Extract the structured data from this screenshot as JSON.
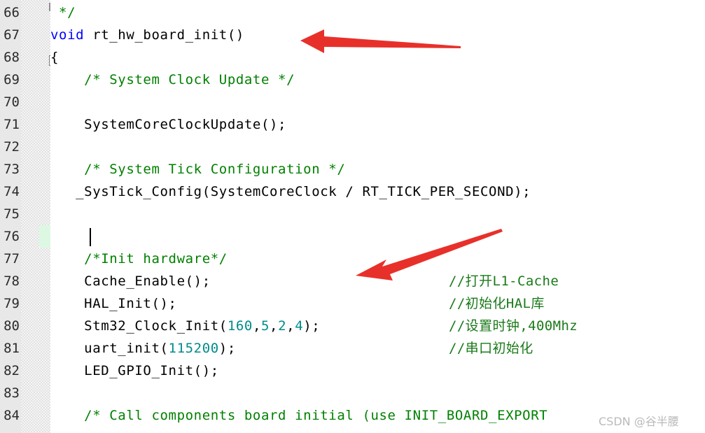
{
  "editor": {
    "language": "c",
    "colors": {
      "keyword": "#0000ff",
      "comment": "#008000",
      "number": "#008b8b",
      "text": "#000000",
      "gutter_bg": "#e8e8e8",
      "fold_bg": "#f5f5f5",
      "current_line_highlight": "#ddf8e2",
      "arrow_accent": "#e8302a",
      "annotation_text": "#1a7a1a"
    },
    "current_line": 76,
    "lines": [
      {
        "no": "66",
        "tokens": [
          {
            "t": " */",
            "c": "cmt"
          }
        ]
      },
      {
        "no": "67",
        "tokens": [
          {
            "t": "void",
            "c": "kw"
          },
          {
            "t": " rt_hw_board_init()",
            "c": "plain"
          }
        ]
      },
      {
        "no": "68",
        "tokens": [
          {
            "t": "{",
            "c": "plain"
          }
        ]
      },
      {
        "no": "69",
        "tokens": [
          {
            "t": "    /* System Clock Update */",
            "c": "cmt"
          }
        ]
      },
      {
        "no": "70",
        "tokens": [
          {
            "t": "",
            "c": "plain"
          }
        ]
      },
      {
        "no": "71",
        "tokens": [
          {
            "t": "    SystemCoreClockUpdate();",
            "c": "plain"
          }
        ]
      },
      {
        "no": "72",
        "tokens": [
          {
            "t": "",
            "c": "plain"
          }
        ]
      },
      {
        "no": "73",
        "tokens": [
          {
            "t": "    /* System Tick Configuration */",
            "c": "cmt"
          }
        ]
      },
      {
        "no": "74",
        "tokens": [
          {
            "t": "   _SysTick_Config(SystemCoreClock / RT_TICK_PER_SECOND);",
            "c": "plain"
          }
        ]
      },
      {
        "no": "75",
        "tokens": [
          {
            "t": "",
            "c": "plain"
          }
        ]
      },
      {
        "no": "76",
        "tokens": [
          {
            "t": "",
            "c": "plain"
          }
        ]
      },
      {
        "no": "77",
        "tokens": [
          {
            "t": "    /*Init hardware*/",
            "c": "cmt"
          }
        ]
      },
      {
        "no": "78",
        "tokens": [
          {
            "t": "    Cache_Enable();",
            "c": "plain"
          }
        ]
      },
      {
        "no": "79",
        "tokens": [
          {
            "t": "    HAL_Init();",
            "c": "plain"
          }
        ]
      },
      {
        "no": "80",
        "tokens": [
          {
            "t": "    Stm32_Clock_Init(",
            "c": "plain"
          },
          {
            "t": "160",
            "c": "num"
          },
          {
            "t": ",",
            "c": "plain"
          },
          {
            "t": "5",
            "c": "num"
          },
          {
            "t": ",",
            "c": "plain"
          },
          {
            "t": "2",
            "c": "num"
          },
          {
            "t": ",",
            "c": "plain"
          },
          {
            "t": "4",
            "c": "num"
          },
          {
            "t": ");",
            "c": "plain"
          }
        ]
      },
      {
        "no": "81",
        "tokens": [
          {
            "t": "    uart_init(",
            "c": "plain"
          },
          {
            "t": "115200",
            "c": "num"
          },
          {
            "t": ");",
            "c": "plain"
          }
        ]
      },
      {
        "no": "82",
        "tokens": [
          {
            "t": "    LED_GPIO_Init();",
            "c": "plain"
          }
        ]
      },
      {
        "no": "83",
        "tokens": [
          {
            "t": "",
            "c": "plain"
          }
        ]
      },
      {
        "no": "84",
        "tokens": [
          {
            "t": "    /* Call components board initial (use INIT_BOARD_EXPORT",
            "c": "cmt"
          }
        ]
      }
    ]
  },
  "annotations": {
    "chinese_comments": [
      {
        "text": "//打开L1-Cache",
        "line": 78
      },
      {
        "text": "//初始化HAL库",
        "line": 79
      },
      {
        "text": "//设置时钟,400Mhz",
        "line": 80
      },
      {
        "text": "//串口初始化",
        "line": 81
      }
    ],
    "arrows": [
      {
        "name": "arrow-to-function-signature",
        "points_to": "rt_hw_board_init()"
      },
      {
        "name": "arrow-to-init-hardware",
        "points_to": "/*Init hardware*/"
      }
    ],
    "watermark": "CSDN @谷半腰"
  }
}
